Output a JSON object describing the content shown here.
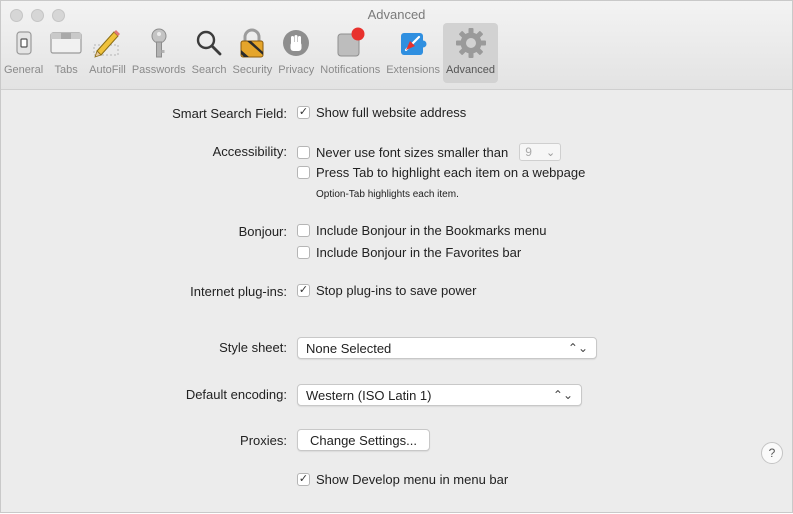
{
  "window": {
    "title": "Advanced"
  },
  "toolbar": {
    "tabs": [
      {
        "label": "General",
        "icon": "general-switch-icon"
      },
      {
        "label": "Tabs",
        "icon": "tabs-icon"
      },
      {
        "label": "AutoFill",
        "icon": "pencil-icon"
      },
      {
        "label": "Passwords",
        "icon": "key-icon"
      },
      {
        "label": "Search",
        "icon": "magnifier-icon"
      },
      {
        "label": "Security",
        "icon": "lock-icon"
      },
      {
        "label": "Privacy",
        "icon": "hand-icon"
      },
      {
        "label": "Notifications",
        "icon": "notification-badge-icon"
      },
      {
        "label": "Extensions",
        "icon": "puzzle-icon"
      },
      {
        "label": "Advanced",
        "icon": "gear-icon"
      }
    ],
    "active_tab": "Advanced"
  },
  "settings": {
    "smart_search": {
      "label": "Smart Search Field:",
      "option": "Show full website address",
      "checked": true
    },
    "accessibility": {
      "label": "Accessibility:",
      "font_option": "Never use font sizes smaller than",
      "font_size": "9",
      "font_checked": false,
      "tab_option": "Press Tab to highlight each item on a webpage",
      "tab_checked": false,
      "note": "Option-Tab highlights each item."
    },
    "bonjour": {
      "label": "Bonjour:",
      "bookmarks_option": "Include Bonjour in the Bookmarks menu",
      "bookmarks_checked": false,
      "favorites_option": "Include Bonjour in the Favorites bar",
      "favorites_checked": false
    },
    "plugins": {
      "label": "Internet plug-ins:",
      "option": "Stop plug-ins to save power",
      "checked": true
    },
    "style_sheet": {
      "label": "Style sheet:",
      "value": "None Selected"
    },
    "encoding": {
      "label": "Default encoding:",
      "value": "Western (ISO Latin 1)"
    },
    "proxies": {
      "label": "Proxies:",
      "button": "Change Settings..."
    },
    "develop": {
      "option": "Show Develop menu in menu bar",
      "checked": true
    }
  },
  "help": {
    "label": "?"
  },
  "glyphs": {
    "check": "✓",
    "chevron": "⌄",
    "updown": "⌃⌄"
  }
}
